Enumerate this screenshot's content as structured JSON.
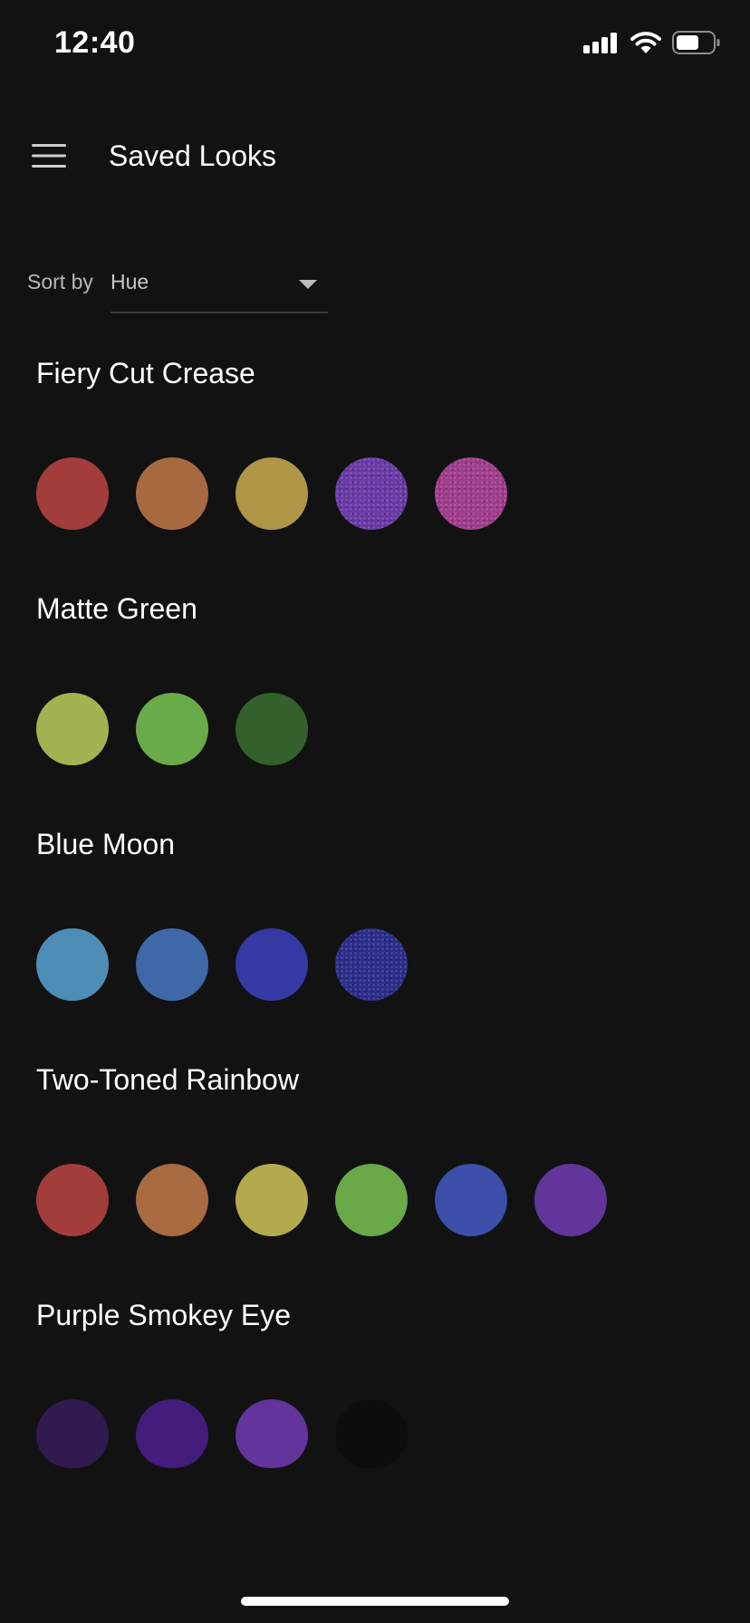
{
  "status_bar": {
    "time": "12:40"
  },
  "header": {
    "title": "Saved Looks"
  },
  "sort": {
    "label": "Sort by",
    "value": "Hue"
  },
  "looks": [
    {
      "name": "Fiery Cut Crease",
      "swatches": [
        {
          "color": "#a23d3c",
          "finish": "matte"
        },
        {
          "color": "#a7693f",
          "finish": "matte"
        },
        {
          "color": "#ae9646",
          "finish": "matte"
        },
        {
          "color": "#6a3aa6",
          "finish": "shimmer"
        },
        {
          "color": "#a03c8e",
          "finish": "shimmer"
        }
      ]
    },
    {
      "name": "Matte Green",
      "swatches": [
        {
          "color": "#a4b351",
          "finish": "matte"
        },
        {
          "color": "#6aab49",
          "finish": "matte"
        },
        {
          "color": "#34612b",
          "finish": "matte"
        }
      ]
    },
    {
      "name": "Blue Moon",
      "swatches": [
        {
          "color": "#4e8db5",
          "finish": "matte"
        },
        {
          "color": "#3f68a8",
          "finish": "matte"
        },
        {
          "color": "#3638a4",
          "finish": "matte"
        },
        {
          "color": "#2c2c8a",
          "finish": "shimmer"
        }
      ]
    },
    {
      "name": "Two-Toned Rainbow",
      "swatches": [
        {
          "color": "#a33d3c",
          "finish": "matte"
        },
        {
          "color": "#a86a40",
          "finish": "matte"
        },
        {
          "color": "#b3aa4e",
          "finish": "matte"
        },
        {
          "color": "#69a948",
          "finish": "matte"
        },
        {
          "color": "#3b4fab",
          "finish": "matte"
        },
        {
          "color": "#61359a",
          "finish": "matte"
        }
      ]
    },
    {
      "name": "Purple Smokey Eye",
      "swatches": [
        {
          "color": "#301a4f",
          "finish": "matte"
        },
        {
          "color": "#431c7c",
          "finish": "matte"
        },
        {
          "color": "#62349c",
          "finish": "matte"
        },
        {
          "color": "#0d0d0d",
          "finish": "matte"
        }
      ]
    }
  ],
  "theme": {
    "background": "#121212",
    "text": "#ffffff",
    "muted_text": "#b8b8b8"
  }
}
